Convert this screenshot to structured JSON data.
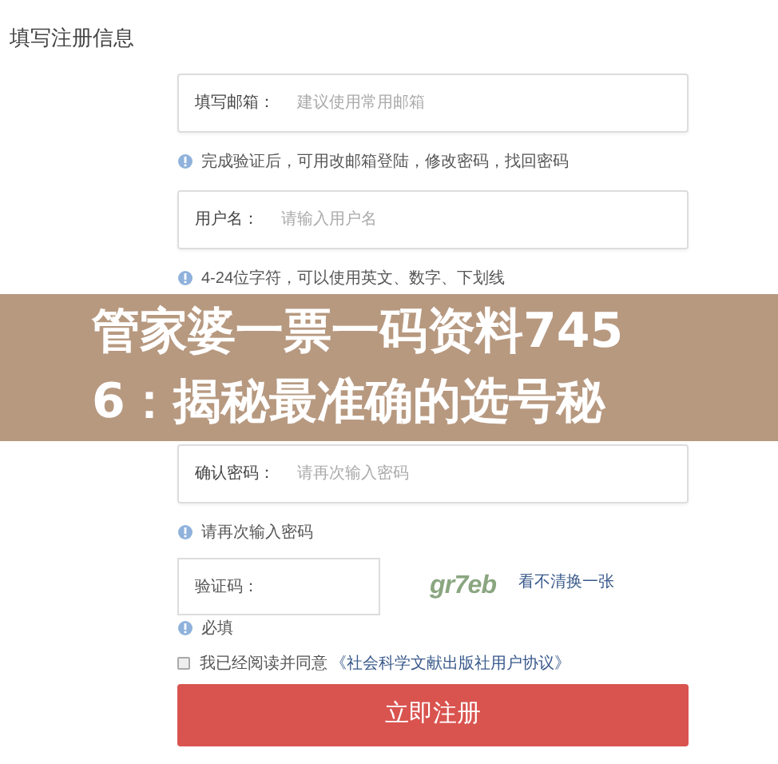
{
  "heading": "填写注册信息",
  "fields": [
    {
      "label": "填写邮箱：",
      "placeholder": "建议使用常用邮箱",
      "hint": "完成验证后，可用改邮箱登陆，修改密码，找回密码"
    },
    {
      "label": "用户名：",
      "placeholder": "请输入用户名",
      "hint": "4-24位字符，可以使用英文、数字、下划线"
    },
    {
      "label": "确认密码：",
      "placeholder": "请再次输入密码",
      "hint": "请再次输入密码"
    }
  ],
  "captcha": {
    "label": "验证码：",
    "code": "gr7eb",
    "refresh_link": "看不清换一张",
    "hint": "必填"
  },
  "agreement": {
    "checked": false,
    "text": "我已经阅读并同意",
    "link": "《社会科学文献出版社用户协议》"
  },
  "submit_button": "立即注册",
  "banner": "管家婆一票一码资料7456：揭秘最准确的选号秘"
}
